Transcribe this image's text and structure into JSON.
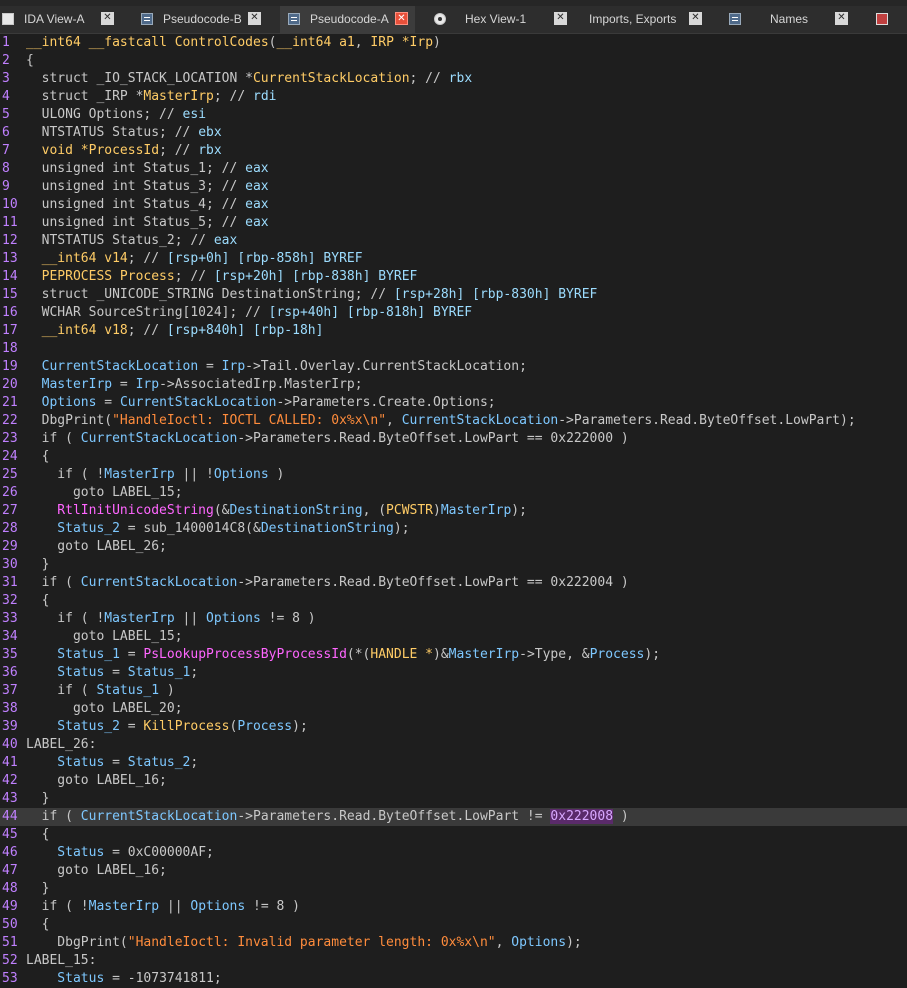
{
  "tabs": [
    {
      "label": "IDA View-A",
      "icon": "graph-icon",
      "active": false
    },
    {
      "label": "Pseudocode-B",
      "icon": "code-icon",
      "active": false
    },
    {
      "label": "Pseudocode-A",
      "icon": "code-icon",
      "active": true
    },
    {
      "label": "Hex View-1",
      "icon": "hex-icon",
      "active": false
    },
    {
      "label": "Imports, Exports",
      "icon": "",
      "active": false
    },
    {
      "label": "Names",
      "icon": "list-icon",
      "active": false
    }
  ],
  "colors": {
    "background": "#1e1e1e",
    "line_number": "#c080ff",
    "highlight_line": "#3a3a3a",
    "string": "#ff8c3c",
    "function": "#ff66ff",
    "variable": "#7ec8ff",
    "type": "#ffcc66"
  },
  "code_lines": [
    {
      "n": "1",
      "segs": [
        [
          "t",
          "__int64"
        ],
        [
          "c",
          " "
        ],
        [
          "t",
          "__fastcall"
        ],
        [
          "c",
          " "
        ],
        [
          "t",
          "ControlCodes"
        ],
        [
          "c",
          "("
        ],
        [
          "t",
          "__int64 a1"
        ],
        [
          "c",
          ", "
        ],
        [
          "t",
          "IRP *Irp"
        ],
        [
          "c",
          ")"
        ]
      ]
    },
    {
      "n": "2",
      "segs": [
        [
          "c",
          "{"
        ]
      ]
    },
    {
      "n": "3",
      "segs": [
        [
          "c",
          "  struct _IO_STACK_LOCATION *"
        ],
        [
          "t",
          "CurrentStackLocation"
        ],
        [
          "c",
          "; // "
        ],
        [
          "k",
          "rbx"
        ]
      ]
    },
    {
      "n": "4",
      "segs": [
        [
          "c",
          "  struct _IRP *"
        ],
        [
          "t",
          "MasterIrp"
        ],
        [
          "c",
          "; // "
        ],
        [
          "k",
          "rdi"
        ]
      ]
    },
    {
      "n": "5",
      "segs": [
        [
          "c",
          "  ULONG Options; // "
        ],
        [
          "k",
          "esi"
        ]
      ]
    },
    {
      "n": "6",
      "segs": [
        [
          "c",
          "  NTSTATUS Status; // "
        ],
        [
          "k",
          "ebx"
        ]
      ]
    },
    {
      "n": "7",
      "segs": [
        [
          "t",
          "  void *ProcessId"
        ],
        [
          "c",
          "; // "
        ],
        [
          "k",
          "rbx"
        ]
      ]
    },
    {
      "n": "8",
      "segs": [
        [
          "c",
          "  unsigned int Status_1; // "
        ],
        [
          "k",
          "eax"
        ]
      ]
    },
    {
      "n": "9",
      "segs": [
        [
          "c",
          "  unsigned int Status_3; // "
        ],
        [
          "k",
          "eax"
        ]
      ]
    },
    {
      "n": "10",
      "segs": [
        [
          "c",
          "  unsigned int Status_4; // "
        ],
        [
          "k",
          "eax"
        ]
      ]
    },
    {
      "n": "11",
      "segs": [
        [
          "c",
          "  unsigned int Status_5; // "
        ],
        [
          "k",
          "eax"
        ]
      ]
    },
    {
      "n": "12",
      "segs": [
        [
          "c",
          "  NTSTATUS Status_2; // "
        ],
        [
          "k",
          "eax"
        ]
      ]
    },
    {
      "n": "13",
      "segs": [
        [
          "t",
          "  __int64 v14"
        ],
        [
          "c",
          "; // "
        ],
        [
          "k",
          "[rsp+0h] [rbp-858h] BYREF"
        ]
      ]
    },
    {
      "n": "14",
      "segs": [
        [
          "t",
          "  PEPROCESS Process"
        ],
        [
          "c",
          "; // "
        ],
        [
          "k",
          "[rsp+20h] [rbp-838h] BYREF"
        ]
      ]
    },
    {
      "n": "15",
      "segs": [
        [
          "c",
          "  struct _UNICODE_STRING DestinationString; // "
        ],
        [
          "k",
          "[rsp+28h] [rbp-830h] BYREF"
        ]
      ]
    },
    {
      "n": "16",
      "segs": [
        [
          "c",
          "  WCHAR SourceString[1024]; // "
        ],
        [
          "k",
          "[rsp+40h] [rbp-818h] BYREF"
        ]
      ]
    },
    {
      "n": "17",
      "segs": [
        [
          "t",
          "  __int64 v18"
        ],
        [
          "c",
          "; // "
        ],
        [
          "k",
          "[rsp+840h] [rbp-18h]"
        ]
      ]
    },
    {
      "n": "18",
      "segs": [
        [
          "c",
          ""
        ]
      ]
    },
    {
      "n": "19",
      "segs": [
        [
          "v",
          "  CurrentStackLocation"
        ],
        [
          "c",
          " = "
        ],
        [
          "v",
          "Irp"
        ],
        [
          "c",
          "->Tail.Overlay.CurrentStackLocation;"
        ]
      ]
    },
    {
      "n": "20",
      "segs": [
        [
          "v",
          "  MasterIrp"
        ],
        [
          "c",
          " = "
        ],
        [
          "v",
          "Irp"
        ],
        [
          "c",
          "->AssociatedIrp.MasterIrp;"
        ]
      ]
    },
    {
      "n": "21",
      "segs": [
        [
          "v",
          "  Options"
        ],
        [
          "c",
          " = "
        ],
        [
          "v",
          "CurrentStackLocation"
        ],
        [
          "c",
          "->Parameters.Create.Options;"
        ]
      ]
    },
    {
      "n": "22",
      "segs": [
        [
          "c",
          "  DbgPrint("
        ],
        [
          "s",
          "\"HandleIoctl: IOCTL CALLED: 0x%x\\n\""
        ],
        [
          "c",
          ", "
        ],
        [
          "v",
          "CurrentStackLocation"
        ],
        [
          "c",
          "->Parameters.Read.ByteOffset.LowPart);"
        ]
      ]
    },
    {
      "n": "23",
      "segs": [
        [
          "c",
          "  if ( "
        ],
        [
          "v",
          "CurrentStackLocation"
        ],
        [
          "c",
          "->Parameters.Read.ByteOffset.LowPart == 0x222000 )"
        ]
      ]
    },
    {
      "n": "24",
      "segs": [
        [
          "c",
          "  {"
        ]
      ]
    },
    {
      "n": "25",
      "segs": [
        [
          "c",
          "    if ( !"
        ],
        [
          "v",
          "MasterIrp"
        ],
        [
          "c",
          " || !"
        ],
        [
          "v",
          "Options"
        ],
        [
          "c",
          " )"
        ]
      ]
    },
    {
      "n": "26",
      "segs": [
        [
          "c",
          "      goto LABEL_15;"
        ]
      ]
    },
    {
      "n": "27",
      "segs": [
        [
          "fn",
          "    RtlInitUnicodeString"
        ],
        [
          "c",
          "(&"
        ],
        [
          "v",
          "DestinationString"
        ],
        [
          "c",
          ", ("
        ],
        [
          "t",
          "PCWSTR"
        ],
        [
          "c",
          ")"
        ],
        [
          "v",
          "MasterIrp"
        ],
        [
          "c",
          ");"
        ]
      ]
    },
    {
      "n": "28",
      "segs": [
        [
          "v",
          "    Status_2"
        ],
        [
          "c",
          " = sub_1400014C8(&"
        ],
        [
          "v",
          "DestinationString"
        ],
        [
          "c",
          ");"
        ]
      ]
    },
    {
      "n": "29",
      "segs": [
        [
          "c",
          "    goto LABEL_26;"
        ]
      ]
    },
    {
      "n": "30",
      "segs": [
        [
          "c",
          "  }"
        ]
      ]
    },
    {
      "n": "31",
      "segs": [
        [
          "c",
          "  if ( "
        ],
        [
          "v",
          "CurrentStackLocation"
        ],
        [
          "c",
          "->Parameters.Read.ByteOffset.LowPart == 0x222004 )"
        ]
      ]
    },
    {
      "n": "32",
      "segs": [
        [
          "c",
          "  {"
        ]
      ]
    },
    {
      "n": "33",
      "segs": [
        [
          "c",
          "    if ( !"
        ],
        [
          "v",
          "MasterIrp"
        ],
        [
          "c",
          " || "
        ],
        [
          "v",
          "Options"
        ],
        [
          "c",
          " != 8 )"
        ]
      ]
    },
    {
      "n": "34",
      "segs": [
        [
          "c",
          "      goto LABEL_15;"
        ]
      ]
    },
    {
      "n": "35",
      "segs": [
        [
          "v",
          "    Status_1"
        ],
        [
          "c",
          " = "
        ],
        [
          "fn",
          "PsLookupProcessByProcessId"
        ],
        [
          "c",
          "(*("
        ],
        [
          "t",
          "HANDLE *"
        ],
        [
          "c",
          ")&"
        ],
        [
          "v",
          "MasterIrp"
        ],
        [
          "c",
          "->Type, &"
        ],
        [
          "v",
          "Process"
        ],
        [
          "c",
          ");"
        ]
      ]
    },
    {
      "n": "36",
      "segs": [
        [
          "v",
          "    Status"
        ],
        [
          "c",
          " = "
        ],
        [
          "v",
          "Status_1"
        ],
        [
          "c",
          ";"
        ]
      ]
    },
    {
      "n": "37",
      "segs": [
        [
          "c",
          "    if ( "
        ],
        [
          "v",
          "Status_1"
        ],
        [
          "c",
          " )"
        ]
      ]
    },
    {
      "n": "38",
      "segs": [
        [
          "c",
          "      goto LABEL_20;"
        ]
      ]
    },
    {
      "n": "39",
      "segs": [
        [
          "v",
          "    Status_2"
        ],
        [
          "c",
          " = "
        ],
        [
          "t",
          "KillProcess"
        ],
        [
          "c",
          "("
        ],
        [
          "v",
          "Process"
        ],
        [
          "c",
          ");"
        ]
      ]
    },
    {
      "n": "40",
      "segs": [
        [
          "c",
          "LABEL_26:"
        ]
      ]
    },
    {
      "n": "41",
      "segs": [
        [
          "v",
          "    Status"
        ],
        [
          "c",
          " = "
        ],
        [
          "v",
          "Status_2"
        ],
        [
          "c",
          ";"
        ]
      ]
    },
    {
      "n": "42",
      "segs": [
        [
          "c",
          "    goto LABEL_16;"
        ]
      ]
    },
    {
      "n": "43",
      "segs": [
        [
          "c",
          "  }"
        ]
      ]
    },
    {
      "n": "44",
      "hl": true,
      "segs": [
        [
          "c",
          "  if ( "
        ],
        [
          "v",
          "CurrentStackLocation"
        ],
        [
          "c",
          "->Parameters.Read.ByteOffset.LowPart != "
        ],
        [
          "sel",
          "0x222008"
        ],
        [
          "c",
          " )"
        ]
      ]
    },
    {
      "n": "45",
      "segs": [
        [
          "c",
          "  {"
        ]
      ]
    },
    {
      "n": "46",
      "segs": [
        [
          "v",
          "    Status"
        ],
        [
          "c",
          " = 0xC00000AF;"
        ]
      ]
    },
    {
      "n": "47",
      "segs": [
        [
          "c",
          "    goto LABEL_16;"
        ]
      ]
    },
    {
      "n": "48",
      "segs": [
        [
          "c",
          "  }"
        ]
      ]
    },
    {
      "n": "49",
      "segs": [
        [
          "c",
          "  if ( !"
        ],
        [
          "v",
          "MasterIrp"
        ],
        [
          "c",
          " || "
        ],
        [
          "v",
          "Options"
        ],
        [
          "c",
          " != 8 )"
        ]
      ]
    },
    {
      "n": "50",
      "segs": [
        [
          "c",
          "  {"
        ]
      ]
    },
    {
      "n": "51",
      "segs": [
        [
          "c",
          "    DbgPrint("
        ],
        [
          "s",
          "\"HandleIoctl: Invalid parameter length: 0x%x\\n\""
        ],
        [
          "c",
          ", "
        ],
        [
          "v",
          "Options"
        ],
        [
          "c",
          ");"
        ]
      ]
    },
    {
      "n": "52",
      "segs": [
        [
          "c",
          "LABEL_15:"
        ]
      ]
    },
    {
      "n": "53",
      "segs": [
        [
          "v",
          "    Status"
        ],
        [
          "c",
          " = -1073741811;"
        ]
      ]
    }
  ]
}
